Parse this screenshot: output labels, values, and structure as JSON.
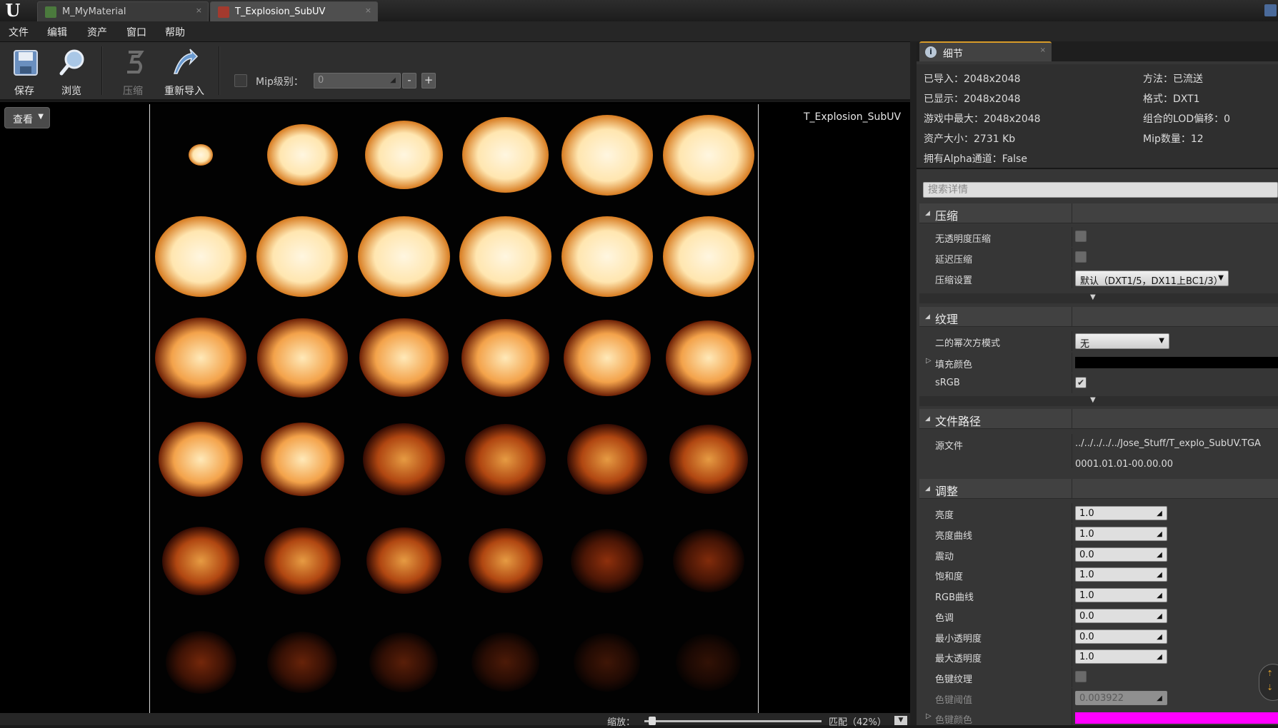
{
  "window": {
    "logo": "U",
    "tabs": [
      {
        "label": "M_MyMaterial",
        "icon": "material-icon",
        "active": false
      },
      {
        "label": "T_Explosion_SubUV",
        "icon": "texture-icon",
        "active": true
      }
    ],
    "tab_close": "×"
  },
  "menu": [
    "文件",
    "编辑",
    "资产",
    "窗口",
    "帮助"
  ],
  "toolbar": {
    "save": "保存",
    "browse": "浏览",
    "compress": "压缩",
    "reimport": "重新导入",
    "mip_label": "Mip级别：",
    "mip_value": "0",
    "minus": "-",
    "plus": "+"
  },
  "viewport": {
    "view_button": "查看",
    "texture_name": "T_Explosion_SubUV",
    "zoom_label": "缩放：",
    "zoom_fit": "匹配（42%）",
    "zoom_percent": 42,
    "flipbook_grid": {
      "columns": 6,
      "rows": 6
    }
  },
  "details": {
    "tab_label": "细节",
    "info_left": [
      "已导入：2048x2048",
      "已显示：2048x2048",
      "游戏中最大：2048x2048",
      "资产大小：2731 Kb",
      "拥有Alpha通道：False"
    ],
    "info_right": [
      "方法：已流送",
      "格式：DXT1",
      "组合的LOD偏移：0",
      "Mip数量：12"
    ],
    "search_placeholder": "搜索详情",
    "categories": {
      "compression": {
        "title": "压缩",
        "no_alpha": "无透明度压缩",
        "deferred": "延迟压缩",
        "settings_label": "压缩设置",
        "settings_value": "默认（DXT1/5，DX11上BC1/3）"
      },
      "texture": {
        "title": "纹理",
        "pow2_label": "二的幂次方模式",
        "pow2_value": "无",
        "pad_color_label": "填充颜色",
        "srgb_label": "sRGB"
      },
      "filepath": {
        "title": "文件路径",
        "source_label": "源文件",
        "source_path": "../../../../../Jose_Stuff/T_explo_SubUV.TGA",
        "source_time": "0001.01.01-00.00.00"
      },
      "adjust": {
        "title": "调整",
        "rows": [
          {
            "label": "亮度",
            "value": "1.0"
          },
          {
            "label": "亮度曲线",
            "value": "1.0"
          },
          {
            "label": "震动",
            "value": "0.0"
          },
          {
            "label": "饱和度",
            "value": "1.0"
          },
          {
            "label": "RGB曲线",
            "value": "1.0"
          },
          {
            "label": "色调",
            "value": "0.0"
          },
          {
            "label": "最小透明度",
            "value": "0.0"
          },
          {
            "label": "最大透明度",
            "value": "1.0"
          }
        ],
        "chroma_key_label": "色键纹理",
        "chroma_threshold_label": "色键阈值",
        "chroma_threshold_value": "0.003922",
        "chroma_color_label": "色键颜色"
      }
    },
    "colors": {
      "pad_color": "#000000",
      "chroma_color": "#ff00ff",
      "accent": "#d79b29"
    }
  }
}
